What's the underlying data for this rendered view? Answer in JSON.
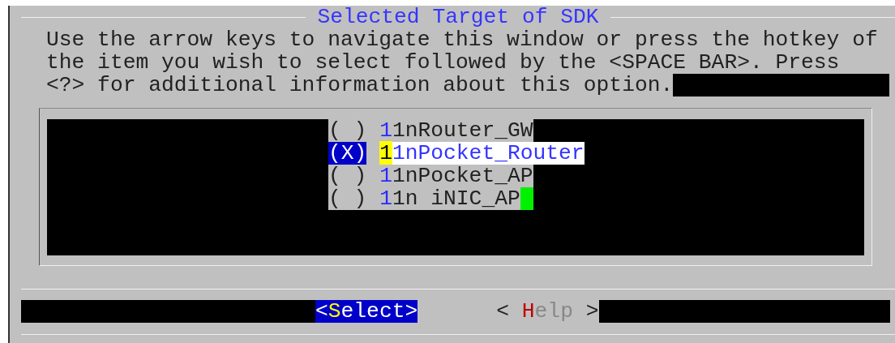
{
  "dialog": {
    "title": "Selected Target of SDK",
    "prompt_lines": [
      "Use the arrow keys to navigate this window or press the hotkey of",
      "the item you wish to select followed by the <SPACE BAR>. Press",
      "<?> for additional information about this option."
    ],
    "items": [
      {
        "radio": "( )",
        "hotkey": "1",
        "rest": "1nRouter_GW",
        "selected": false,
        "cursor": false
      },
      {
        "radio": "(X)",
        "hotkey": "1",
        "rest": "1nPocket_Router",
        "selected": true,
        "cursor": false
      },
      {
        "radio": "( )",
        "hotkey": "1",
        "rest": "1nPocket_AP",
        "selected": false,
        "cursor": false
      },
      {
        "radio": "( )",
        "hotkey": "1",
        "rest": "1n iNIC_AP",
        "selected": false,
        "cursor": true
      }
    ],
    "buttons": [
      {
        "open": "<",
        "hotkey": "S",
        "rest": "elect",
        "close": ">",
        "selected": true
      },
      {
        "open": "< ",
        "hotkey": "H",
        "rest": "elp",
        "close": " >",
        "selected": false
      }
    ]
  }
}
